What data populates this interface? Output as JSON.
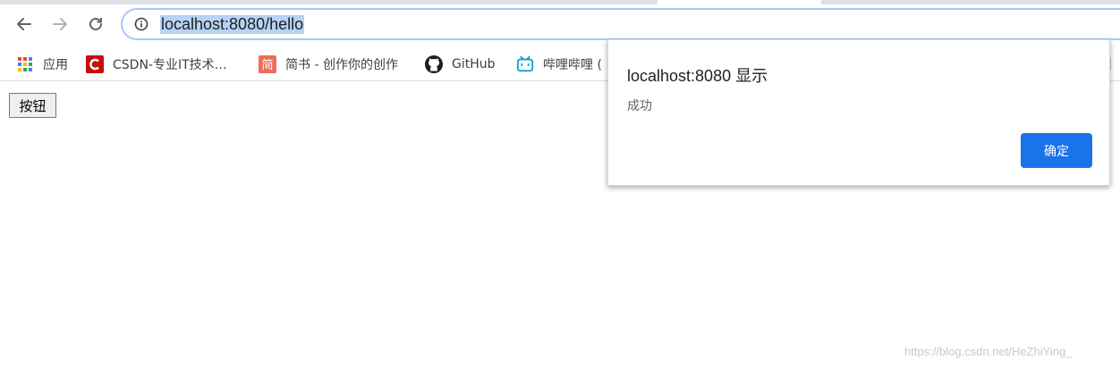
{
  "browser": {
    "url": "localhost:8080/hello"
  },
  "bookmarks": [
    {
      "label": "应用",
      "icon": "apps-grid-icon"
    },
    {
      "label": "CSDN-专业IT技术…",
      "icon": "csdn-logo-icon"
    },
    {
      "label": "简书 - 创作你的创作",
      "icon": "jianshu-logo-icon"
    },
    {
      "label": "GitHub",
      "icon": "github-logo-icon"
    },
    {
      "label": "哔哩哔哩 (",
      "icon": "bilibili-logo-icon"
    }
  ],
  "bookmarks_overflow": "…",
  "page": {
    "button_label": "按钮"
  },
  "dialog": {
    "title": "localhost:8080 显示",
    "message": "成功",
    "ok_label": "确定"
  },
  "watermark": "https://blog.csdn.net/HeZhiYing_",
  "colors": {
    "accent": "#1a73e8",
    "url_highlight": "#b6d2f5",
    "omnibox_border": "#a8c7fa"
  }
}
